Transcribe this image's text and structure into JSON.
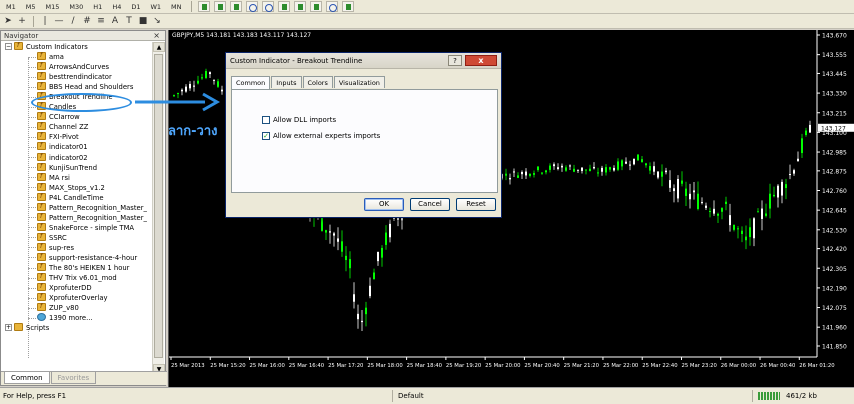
{
  "toolbar": {
    "timeframes": [
      "M1",
      "M5",
      "M15",
      "M30",
      "H1",
      "H4",
      "D1",
      "W1",
      "MN"
    ]
  },
  "navigator": {
    "title": "Navigator",
    "close": "×",
    "root": "Custom Indicators",
    "items": [
      "ama",
      "ArrowsAndCurves",
      "besttrendindicator",
      "BBS Head and Shoulders",
      "Breakout Trendline",
      "Candles",
      "CCIarrow",
      "Channel ZZ",
      "FXI-Pivot",
      "indicator01",
      "indicator02",
      "KunjiSunTrend",
      "MA rsi",
      "MAX_Stops_v1.2",
      "P4L CandleTime",
      "Pattern_Recognition_Master_",
      "Pattern_Recognition_Master_",
      "SnakeForce - simple TMA",
      "SSRC",
      "sup-res",
      "support-resistance-4-hour",
      "The 80's HEIKEN 1 hour",
      "THV Trix v6.01_mod",
      "XprofuterDD",
      "XprofuterOverlay",
      "ZUP_v80",
      "1390 more..."
    ],
    "scripts": "Scripts",
    "tabs": {
      "common": "Common",
      "favorites": "Favorites"
    }
  },
  "annotation": {
    "drag_label": "ลาก-วาง"
  },
  "chart": {
    "symbol_line": "GBPJPY,M5  143.181 143.183 143.117 143.127",
    "current_price": "143.127",
    "price_labels": [
      "143.670",
      "143.555",
      "143.445",
      "143.330",
      "143.215",
      "143.100",
      "142.985",
      "142.875",
      "142.760",
      "142.645",
      "142.530",
      "142.420",
      "142.305",
      "142.190",
      "142.075",
      "141.960",
      "141.850"
    ],
    "time_labels": [
      "25 Mar 2013",
      "25 Mar 15:20",
      "25 Mar 16:00",
      "25 Mar 16:40",
      "25 Mar 17:20",
      "25 Mar 18:00",
      "25 Mar 18:40",
      "25 Mar 19:20",
      "25 Mar 20:00",
      "25 Mar 20:40",
      "25 Mar 21:20",
      "25 Mar 22:00",
      "25 Mar 22:40",
      "25 Mar 23:20",
      "26 Mar 00:00",
      "26 Mar 00:40",
      "26 Mar 01:20"
    ],
    "colors": {
      "bull": "#00ff00",
      "bear": "#ffffff",
      "axis": "#ffffff",
      "background": "#000000"
    }
  },
  "dialog": {
    "title": "Custom Indicator - Breakout Trendline",
    "help": "?",
    "close": "x",
    "tabs": [
      "Common",
      "Inputs",
      "Colors",
      "Visualization"
    ],
    "checkboxes": [
      {
        "label": "Allow DLL imports",
        "checked": false
      },
      {
        "label": "Allow external experts imports",
        "checked": true
      }
    ],
    "buttons": {
      "ok": "OK",
      "cancel": "Cancel",
      "reset": "Reset"
    }
  },
  "status": {
    "help": "For Help, press F1",
    "profile": "Default",
    "traffic": "461/2 kb"
  }
}
